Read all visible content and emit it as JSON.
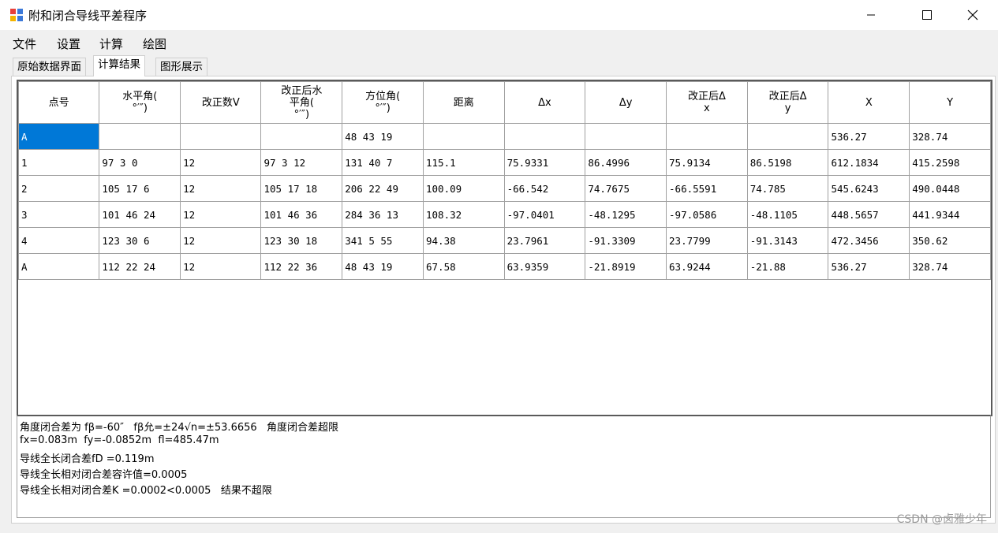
{
  "window": {
    "title": "附和闭合导线平差程序",
    "controls": [
      "minimize",
      "maximize",
      "close"
    ]
  },
  "menu": {
    "items": [
      "文件",
      "设置",
      "计算",
      "绘图"
    ]
  },
  "tabs": [
    {
      "label": "原始数据界面",
      "active": false
    },
    {
      "label": "计算结果",
      "active": true
    },
    {
      "label": "图形展示",
      "active": false
    }
  ],
  "table": {
    "headers": [
      "点号",
      "水平角(\n°′″)",
      "改正数V",
      "改正后水\n平角(\n°′″)",
      "方位角(\n°′″)",
      "距离",
      "Δx",
      "Δy",
      "改正后Δ\nx",
      "改正后Δ\ny",
      "X",
      "Y"
    ],
    "rows": [
      [
        "A",
        "",
        "",
        "",
        "48 43 19",
        "",
        "",
        "",
        "",
        "",
        "536.27",
        "328.74"
      ],
      [
        "1",
        "97 3 0",
        "12",
        "97 3 12",
        "131 40 7",
        "115.1",
        "75.9331",
        "86.4996",
        "75.9134",
        "86.5198",
        "612.1834",
        "415.2598"
      ],
      [
        "2",
        "105 17 6",
        "12",
        "105 17 18",
        "206 22 49",
        "100.09",
        "-66.542",
        "74.7675",
        "-66.5591",
        "74.785",
        "545.6243",
        "490.0448"
      ],
      [
        "3",
        "101 46 24",
        "12",
        "101 46 36",
        "284 36 13",
        "108.32",
        "-97.0401",
        "-48.1295",
        "-97.0586",
        "-48.1105",
        "448.5657",
        "441.9344"
      ],
      [
        "4",
        "123 30 6",
        "12",
        "123 30 18",
        "341 5 55",
        "94.38",
        "23.7961",
        "-91.3309",
        "23.7799",
        "-91.3143",
        "472.3456",
        "350.62"
      ],
      [
        "A",
        "112 22 24",
        "12",
        "112 22 36",
        "48 43 19",
        "67.58",
        "63.9359",
        "-21.8919",
        "63.9244",
        "-21.88",
        "536.27",
        "328.74"
      ]
    ]
  },
  "results": {
    "lines": [
      "角度闭合差为 fβ=-60″   fβ允=±24√n=±53.6656   角度闭合差超限",
      "fx=0.083m  fy=-0.0852m  fl=485.47m",
      "导线全长闭合差fD =0.119m",
      "导线全长相对闭合差容许值=0.0005",
      "导线全长相对闭合差K =0.0002<0.0005   结果不超限"
    ]
  },
  "watermark": "CSDN @卤雅少年",
  "colors": {
    "selection": "#0078d7",
    "grid_border": "#5a5a5a"
  }
}
